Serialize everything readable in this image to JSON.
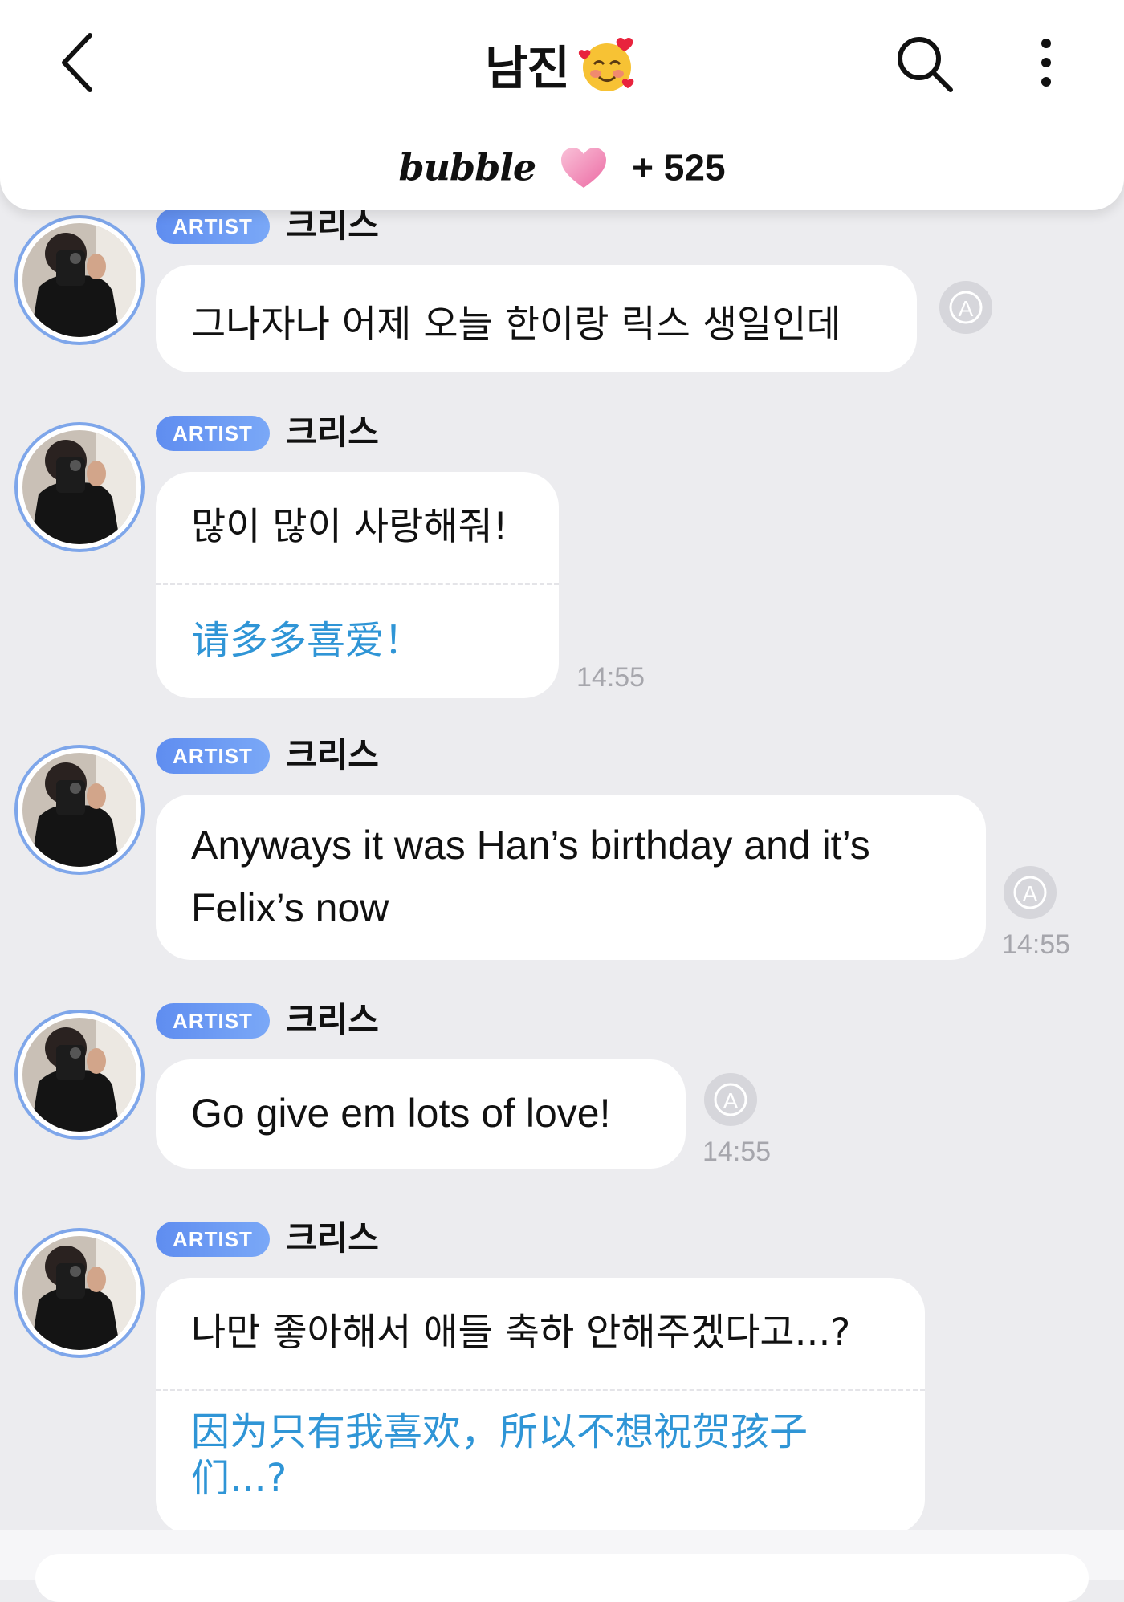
{
  "header": {
    "title": "남진",
    "title_emoji": "smiling-face-with-hearts-icon",
    "bubble_logo": "bubble",
    "bubble_count": "+ 525"
  },
  "colors": {
    "background": "#ececef",
    "artist_badge": "#6b99f3",
    "translation_text": "#2f95d6",
    "timestamp": "#a6a6ac"
  },
  "messages": [
    {
      "badge": "ARTIST",
      "sender": "크리스",
      "text": "그나자나 어제 오늘 한이랑 릭스 생일인데",
      "translation": "",
      "time": ""
    },
    {
      "badge": "ARTIST",
      "sender": "크리스",
      "text": "많이 많이 사랑해줘!",
      "translation": "请多多喜爱！",
      "time": "14:55"
    },
    {
      "badge": "ARTIST",
      "sender": "크리스",
      "text": "Anyways it was Han’s birthday and it’s Felix’s now",
      "translation": "",
      "time": "14:55"
    },
    {
      "badge": "ARTIST",
      "sender": "크리스",
      "text": "Go give em lots of love!",
      "translation": "",
      "time": "14:55"
    },
    {
      "badge": "ARTIST",
      "sender": "크리스",
      "text": "나만 좋아해서 애들 축하 안해주겠다고...?",
      "translation": "因为只有我喜欢，所以不想祝贺孩子们...?",
      "time": ""
    }
  ]
}
